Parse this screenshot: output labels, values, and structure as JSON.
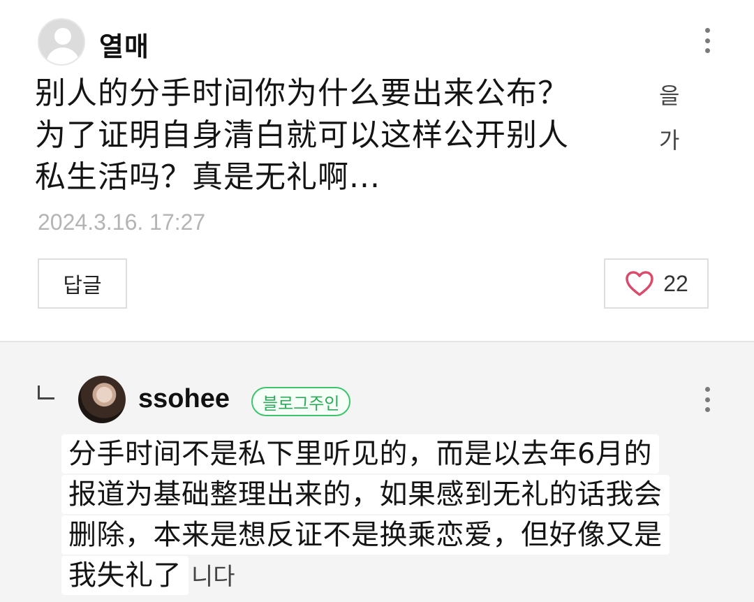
{
  "comment": {
    "author": "열매",
    "text_lines": [
      "别人的分手时间你为什么要出来公布？",
      "为了证明自身清白就可以这样公开别人",
      "私生活吗？真是无礼啊..."
    ],
    "overlay_fragments": [
      "을",
      "가"
    ],
    "timestamp": "2024.3.16. 17:27",
    "reply_label": "답글",
    "like_count": "22"
  },
  "reply": {
    "author": "ssohee",
    "badge": "블로그주인",
    "text_lines": [
      "分手时间不是私下里听见的，而是以去年6月的",
      "报道为基础整理出来的，如果感到无礼的话我会",
      "删除，本来是想反证不是换乘恋爱，但好像又是",
      "我失礼了"
    ],
    "tail_fragment": "니다"
  },
  "icons": {
    "avatar_default": "default-avatar-icon",
    "more": "more-vertical-icon",
    "reply_arrow": "reply-arrow-icon",
    "heart": "heart-outline-icon"
  },
  "colors": {
    "heart": "#d94a6c",
    "badge": "#3cc46b",
    "timestamp": "#b4b4b4",
    "reply_bg": "#f4f4f4"
  }
}
